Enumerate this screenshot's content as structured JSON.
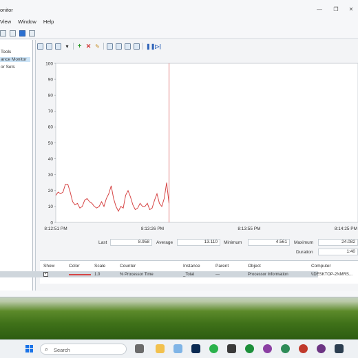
{
  "window": {
    "title": "onitor"
  },
  "menu": {
    "items": [
      "View",
      "Window",
      "Help"
    ]
  },
  "tree": {
    "items": [
      "Tools",
      "ance Monitor",
      "or Sets"
    ]
  },
  "chart_data": {
    "type": "line",
    "title": "",
    "xlabel": "",
    "ylabel": "",
    "ylim": [
      0,
      100
    ],
    "y_ticks": [
      "100",
      "90",
      "80",
      "70",
      "60",
      "50",
      "40",
      "30",
      "20",
      "10",
      "0"
    ],
    "x_ticks": [
      "8:12:51 PM",
      "8:13:26 PM",
      "8:13:55 PM",
      "8:14:25 PM"
    ],
    "grid": false,
    "series": [
      {
        "color": "#d64545",
        "values": [
          17,
          19,
          18,
          19,
          24,
          24,
          19,
          13,
          11,
          12,
          9,
          10,
          14,
          15,
          13,
          12,
          10,
          9,
          10,
          13,
          10,
          15,
          18,
          23,
          15,
          10,
          7,
          10,
          9,
          17,
          20,
          16,
          11,
          8,
          9,
          12,
          10,
          10,
          12,
          8,
          9,
          14,
          18,
          12,
          10,
          15,
          25,
          12
        ]
      }
    ]
  },
  "stats": {
    "last_label": "Last",
    "last_value": "8.958",
    "average_label": "Average",
    "average_value": "13.110",
    "minimum_label": "Minimum",
    "minimum_value": "4.561",
    "maximum_label": "Maximum",
    "maximum_value": "24.082",
    "duration_label": "Duration",
    "duration_value": "1:40"
  },
  "table": {
    "headers": [
      "Show",
      "Color",
      "Scale",
      "Counter",
      "Instance",
      "Parent",
      "Object",
      "Computer"
    ],
    "row": {
      "show": "✓",
      "scale": "1.0",
      "counter": "% Processor Time",
      "instance": "_Total",
      "parent": "---",
      "object": "Processor Information",
      "computer": "\\\\DESKTOP-2NMRS..."
    }
  },
  "taskbar": {
    "search_placeholder": "Search"
  },
  "colors": {
    "accent": "#d64545",
    "selection": "#cce4f7"
  }
}
